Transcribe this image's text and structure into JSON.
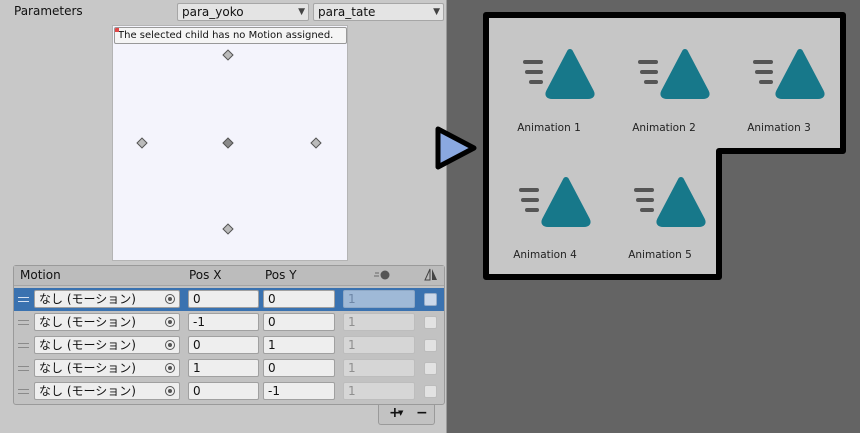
{
  "parameters": {
    "label": "Parameters",
    "param_x": "para_yoko",
    "param_y": "para_tate"
  },
  "blend_tree": {
    "warning": "The selected child has no Motion assigned."
  },
  "table": {
    "headers": {
      "motion": "Motion",
      "pos_x": "Pos X",
      "pos_y": "Pos Y"
    },
    "rows": [
      {
        "motion": "なし (モーション)",
        "pos_x": "0",
        "pos_y": "0",
        "speed": "1",
        "selected": true
      },
      {
        "motion": "なし (モーション)",
        "pos_x": "-1",
        "pos_y": "0",
        "speed": "1",
        "selected": false
      },
      {
        "motion": "なし (モーション)",
        "pos_x": "0",
        "pos_y": "1",
        "speed": "1",
        "selected": false
      },
      {
        "motion": "なし (モーション)",
        "pos_x": "1",
        "pos_y": "0",
        "speed": "1",
        "selected": false
      },
      {
        "motion": "なし (モーション)",
        "pos_x": "0",
        "pos_y": "-1",
        "speed": "1",
        "selected": false
      }
    ],
    "footer": {
      "add": "+",
      "remove": "−"
    }
  },
  "assets": {
    "icon": "animation-clip-icon",
    "icon_color": "#17788a",
    "items": [
      {
        "label": "Animation 1"
      },
      {
        "label": "Animation 2"
      },
      {
        "label": "Animation 3"
      },
      {
        "label": "Animation 4"
      },
      {
        "label": "Animation 5"
      }
    ]
  },
  "colors": {
    "selection": "#3a72b0",
    "arrow": "#8aa8e0"
  }
}
